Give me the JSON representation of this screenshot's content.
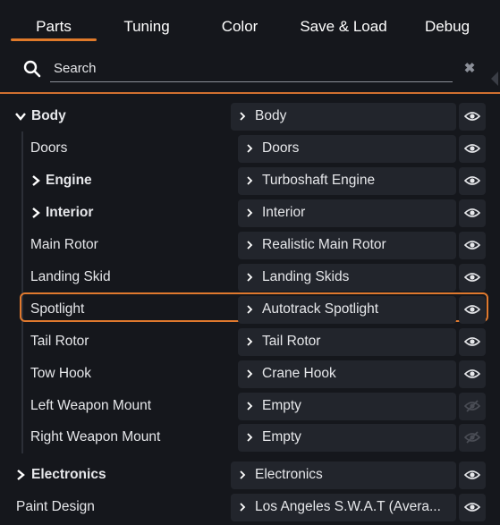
{
  "tabs": [
    {
      "label": "Parts",
      "active": true
    },
    {
      "label": "Tuning",
      "active": false
    },
    {
      "label": "Color",
      "active": false
    },
    {
      "label": "Save & Load",
      "active": false
    },
    {
      "label": "Debug",
      "active": false
    }
  ],
  "search": {
    "placeholder": "Search",
    "value": "",
    "clear_icon": "close-icon"
  },
  "colors": {
    "accent": "#e07a2a",
    "background": "#15171c",
    "slot_bg": "#22252c",
    "text": "#e6e7ea",
    "eye_disabled": "#4a4d55"
  },
  "rows": [
    {
      "label": "Body",
      "bold": true,
      "expander": "expanded",
      "slot": "Body",
      "visible": true
    },
    {
      "label": "Doors",
      "bold": false,
      "expander": "none",
      "slot": "Doors",
      "visible": true
    },
    {
      "label": "Engine",
      "bold": true,
      "expander": "collapsed",
      "slot": "Turboshaft Engine",
      "visible": true
    },
    {
      "label": "Interior",
      "bold": true,
      "expander": "collapsed",
      "slot": "Interior",
      "visible": true
    },
    {
      "label": "Main Rotor",
      "bold": false,
      "expander": "none",
      "slot": "Realistic Main Rotor",
      "visible": true
    },
    {
      "label": "Landing Skid",
      "bold": false,
      "expander": "none",
      "slot": "Landing Skids",
      "visible": true
    },
    {
      "label": "Spotlight",
      "bold": false,
      "expander": "none",
      "slot": "Autotrack Spotlight",
      "visible": true,
      "selected": true
    },
    {
      "label": "Tail Rotor",
      "bold": false,
      "expander": "none",
      "slot": "Tail Rotor",
      "visible": true
    },
    {
      "label": "Tow Hook",
      "bold": false,
      "expander": "none",
      "slot": "Crane Hook",
      "visible": true
    },
    {
      "label": "Left Weapon Mount",
      "bold": false,
      "expander": "none",
      "slot": "Empty",
      "visible": false
    },
    {
      "label": "Right Weapon Mount",
      "bold": false,
      "expander": "none",
      "slot": "Empty",
      "visible": false
    },
    {
      "label": "Electronics",
      "bold": true,
      "expander": "collapsed",
      "slot": "Electronics",
      "visible": true
    },
    {
      "label": "Paint Design",
      "bold": false,
      "expander": "none",
      "slot": "Los Angeles S.W.A.T (Avera...",
      "visible": true
    }
  ]
}
